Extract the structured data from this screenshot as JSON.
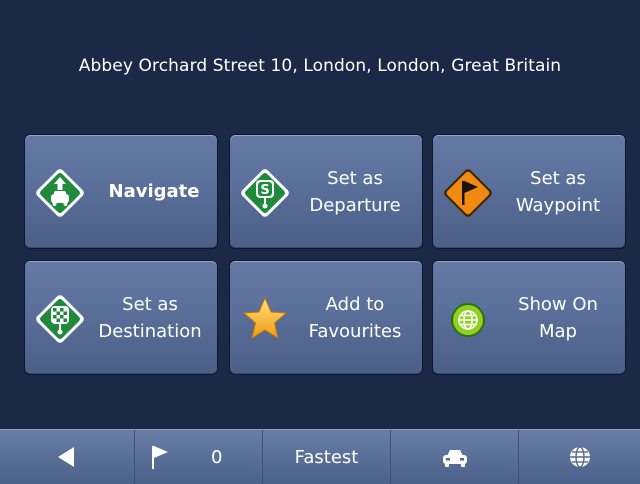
{
  "address": "Abbey Orchard Street 10, London, London, Great Britain",
  "tiles": [
    {
      "lines": [
        "Navigate"
      ],
      "icon": "navigate-icon"
    },
    {
      "lines": [
        "Set as",
        "Departure"
      ],
      "icon": "departure-icon"
    },
    {
      "lines": [
        "Set as",
        "Waypoint"
      ],
      "icon": "waypoint-flag-icon"
    },
    {
      "lines": [
        "Set as",
        "Destination"
      ],
      "icon": "destination-checkered-icon"
    },
    {
      "lines": [
        "Add to",
        "Favourites"
      ],
      "icon": "star-icon"
    },
    {
      "lines": [
        "Show On",
        "Map"
      ],
      "icon": "globe-icon"
    }
  ],
  "bottombar": {
    "back_icon": "back-arrow-icon",
    "waypoint_count": "0",
    "route_mode": "Fastest",
    "vehicle_icon": "car-icon",
    "globe_icon": "globe-icon"
  },
  "colors": {
    "background": "#1b2947",
    "tile": "#5a6f99",
    "green_icon": "#1f8a3c",
    "orange_icon": "#f08a10"
  }
}
